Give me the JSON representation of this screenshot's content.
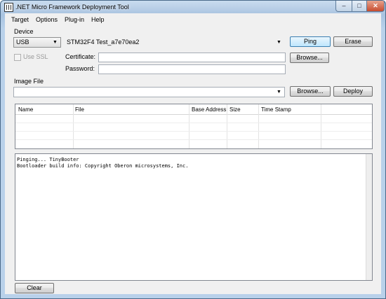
{
  "window": {
    "title": ".NET Micro Framework Deployment Tool",
    "caption_buttons": {
      "minimize": "–",
      "maximize": "□",
      "close": "✕"
    }
  },
  "menu": [
    "Target",
    "Options",
    "Plug-in",
    "Help"
  ],
  "device": {
    "group_label": "Device",
    "transport": "USB",
    "device_name": "STM32F4 Test_a7e70ea2",
    "ping_label": "Ping",
    "erase_label": "Erase",
    "use_ssl_label": "Use SSL",
    "certificate_label": "Certificate:",
    "certificate_value": "",
    "password_label": "Password:",
    "password_value": "",
    "browse_label": "Browse..."
  },
  "image_file": {
    "label": "Image File",
    "value": "",
    "browse_label": "Browse...",
    "deploy_label": "Deploy"
  },
  "table": {
    "columns": [
      "Name",
      "File",
      "Base Address",
      "Size",
      "Time Stamp"
    ],
    "rows": []
  },
  "output": {
    "lines": [
      "Pinging... TinyBooter",
      "Bootloader build info: Copyright Oberon microsystems, Inc."
    ]
  },
  "clear_label": "Clear",
  "icons": {
    "dropdown": "▼"
  }
}
